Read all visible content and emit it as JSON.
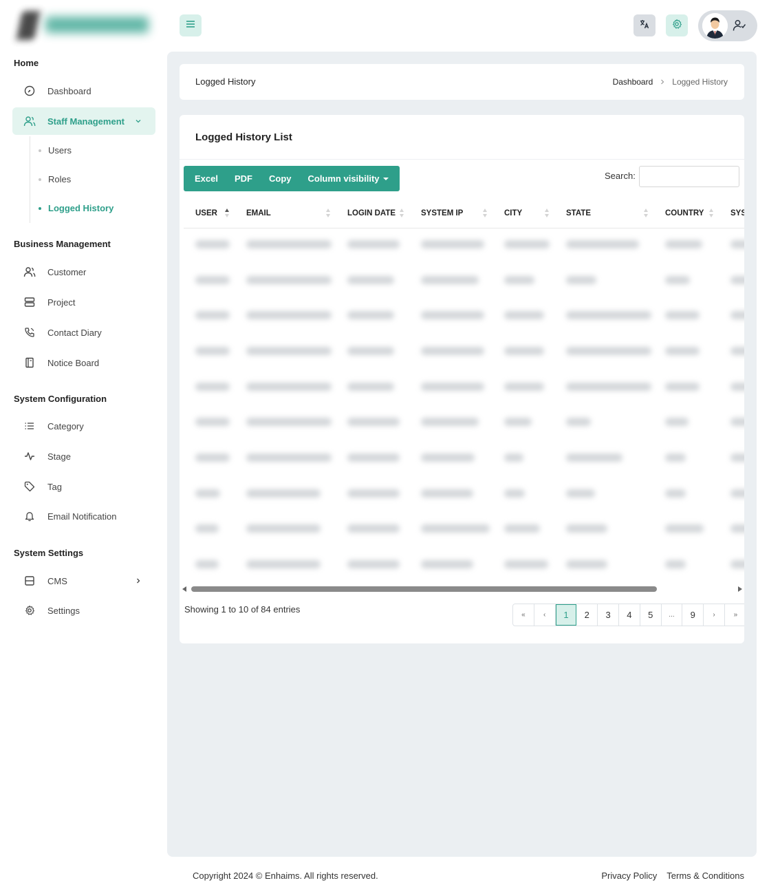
{
  "sidebar": {
    "sections": {
      "home": "Home",
      "business": "Business Management",
      "config": "System Configuration",
      "settings": "System Settings"
    },
    "items": {
      "dashboard": "Dashboard",
      "staff": "Staff Management",
      "customer": "Customer",
      "project": "Project",
      "contact_diary": "Contact Diary",
      "notice_board": "Notice Board",
      "category": "Category",
      "stage": "Stage",
      "tag": "Tag",
      "email_notification": "Email Notification",
      "cms": "CMS",
      "settings": "Settings"
    },
    "sub_items": {
      "users": "Users",
      "roles": "Roles",
      "logged_history": "Logged History"
    }
  },
  "page": {
    "title": "Logged History",
    "breadcrumb": {
      "parent": "Dashboard",
      "current": "Logged History"
    }
  },
  "card": {
    "title": "Logged History List",
    "buttons": {
      "excel": "Excel",
      "pdf": "PDF",
      "copy": "Copy",
      "column_visibility": "Column visibility"
    },
    "search_label": "Search:",
    "search_value": ""
  },
  "table": {
    "columns": [
      "USER",
      "EMAIL",
      "LOGIN DATE",
      "SYSTEM IP",
      "CITY",
      "STATE",
      "COUNTRY",
      "SYS"
    ]
  },
  "pagination": {
    "info": "Showing 1 to 10 of 84 entries",
    "first": "«",
    "prev": "‹",
    "pages": [
      "1",
      "2",
      "3",
      "4",
      "5",
      "...",
      "9"
    ],
    "next": "›",
    "last": "»",
    "current_page": 1
  },
  "footer": {
    "copyright": "Copyright 2024 © Enhaims. All rights reserved.",
    "privacy": "Privacy Policy",
    "terms": "Terms & Conditions"
  },
  "colors": {
    "accent": "#2e9f8a",
    "accent_light": "#d7f0ea",
    "content_bg": "#ebeff2"
  }
}
